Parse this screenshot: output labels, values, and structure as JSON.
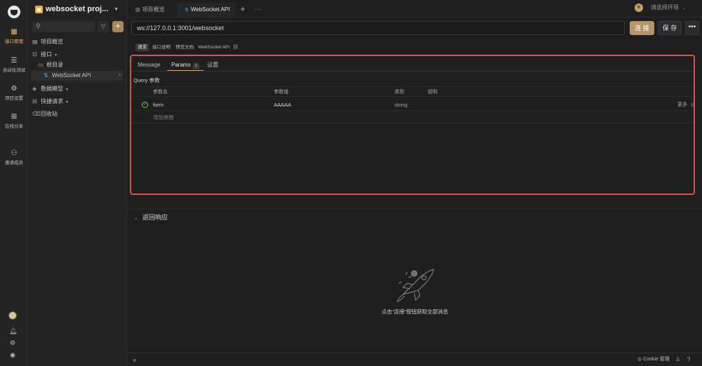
{
  "rail": {
    "items": [
      {
        "label": "接口管理",
        "icon": "api-icon",
        "glyph": "▦",
        "active": true
      },
      {
        "label": "自动化测试",
        "icon": "test-icon",
        "glyph": "☰",
        "active": false
      },
      {
        "label": "项目设置",
        "icon": "settings-icon",
        "glyph": "⚙",
        "active": false
      },
      {
        "label": "在线分享",
        "icon": "share-icon",
        "glyph": "⊞",
        "active": false
      },
      {
        "label": "邀请成员",
        "icon": "invite-icon",
        "glyph": "⚇",
        "active": false
      }
    ]
  },
  "side": {
    "project_name": "websocket proj...",
    "search_placeholder": "",
    "tree": {
      "overview": "项目概览",
      "api": "接口",
      "root": "根目录",
      "websocket_api": "WebSocket API",
      "models": "数据模型",
      "quick": "快捷请求",
      "trash": "回收站"
    }
  },
  "tabs": {
    "overview": "项目概览",
    "websocket": "WebSocket API",
    "add": "+",
    "more": "···",
    "env_placeholder": "请选择环境"
  },
  "request": {
    "url": "ws://127.0.0.1:3001/websocket",
    "connect": "连 接",
    "save": "保 存",
    "more": "•••",
    "subtabs": [
      "请求",
      "接口说明",
      "预览文档",
      "WebSocket API"
    ],
    "panel_tabs": {
      "message": "Message",
      "params": "Params",
      "params_count": "1",
      "settings": "设置"
    },
    "query_label": "Query 参数",
    "columns": {
      "name": "参数名",
      "value": "参数值",
      "type": "类型",
      "desc": "说明"
    },
    "params": [
      {
        "name": "form",
        "value": "AAAAA",
        "type": "string",
        "desc": "",
        "more": "更多"
      }
    ],
    "add_param": "添加参数"
  },
  "response": {
    "title": "返回响应",
    "empty_text": "点击“连接”按钮获取全部消息"
  },
  "statusbar": {
    "collapse": "«",
    "cookie": "Cookie 管理"
  },
  "colors": {
    "accent": "#b89566",
    "highlight_border": "#e0504a",
    "type_green": "#7cc26b"
  }
}
